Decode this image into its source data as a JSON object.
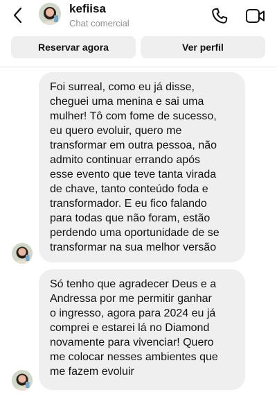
{
  "header": {
    "name": "kefiisa",
    "subtitle": "Chat comercial",
    "back_icon": "chevron-left-icon",
    "call_icon": "phone-icon",
    "video_icon": "video-camera-icon"
  },
  "actions": {
    "book_label": "Reservar agora",
    "profile_label": "Ver perfil"
  },
  "messages": [
    {
      "text": "Foi surreal, como eu já disse,\ncheguei uma menina e sai uma\nmulher! Tô com fome de sucesso,\neu quero evoluir, quero me\ntransformar em outra pessoa, não\nadmito continuar errando após\nesse evento que teve tanta virada\nde chave, tanto conteúdo foda e\ntransformador. E eu fico falando\npara todas que não foram, estão\nperdendo uma oportunidade de se\ntransformar na sua melhor versão"
    },
    {
      "text": "Só tenho que agradecer Deus e a\nAndressa por me permitir ganhar\no ingresso, agora para 2024 eu já\ncomprei e estarei lá no Diamond\nnovamente para vivenciar! Quero\nme colocar nesses ambientes que\nme fazem evoluir"
    }
  ],
  "colors": {
    "bubble_bg": "#efefef",
    "button_bg": "#efefef",
    "text": "#111111",
    "subtext": "#8e8e8e"
  }
}
